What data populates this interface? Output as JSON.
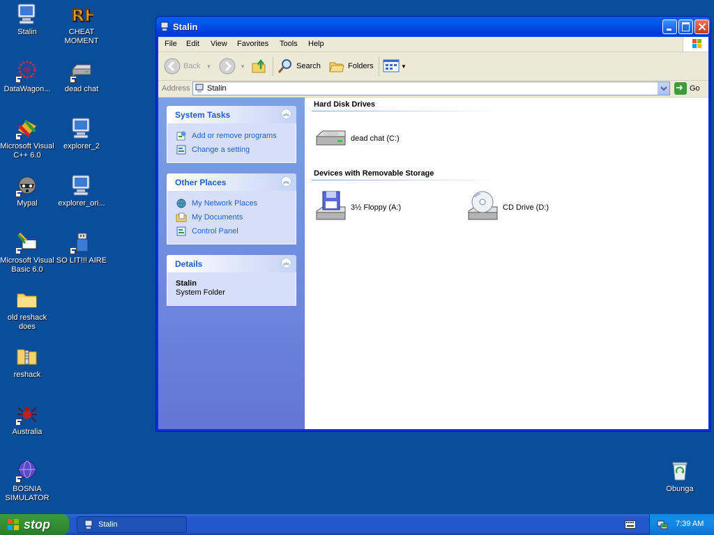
{
  "desktop": {
    "icons": [
      {
        "label": "Stalin",
        "icon": "my-computer-icon",
        "shortcut": false
      },
      {
        "label": "CHEAT MOMENT",
        "icon": "resource-hacker-icon",
        "shortcut": false
      },
      {
        "label": "DataWagon...",
        "icon": "datawagon-icon",
        "shortcut": true
      },
      {
        "label": "dead chat",
        "icon": "hard-disk-icon",
        "shortcut": true
      },
      {
        "label": "Microsoft Visual C++ 6.0",
        "icon": "visual-cpp-icon",
        "shortcut": true
      },
      {
        "label": "explorer_2",
        "icon": "computer-icon",
        "shortcut": false
      },
      {
        "label": "Mypal",
        "icon": "raccoon-icon",
        "shortcut": true
      },
      {
        "label": "explorer_ori...",
        "icon": "computer-icon",
        "shortcut": false
      },
      {
        "label": "Microsoft Visual Basic 6.0",
        "icon": "visual-basic-icon",
        "shortcut": true
      },
      {
        "label": "SO LIT!!! AIRE",
        "icon": "usb-drive-icon",
        "shortcut": true
      },
      {
        "label": "old reshack does",
        "icon": "folder-icon",
        "shortcut": false
      },
      {
        "label": "reshack",
        "icon": "zip-folder-icon",
        "shortcut": false
      },
      {
        "label": "Australia",
        "icon": "spider-icon",
        "shortcut": true
      },
      {
        "label": "BOSNIA SIMULATOR",
        "icon": "globe-app-icon",
        "shortcut": true
      },
      {
        "label": "Obunga",
        "icon": "recycle-bin-icon",
        "shortcut": false
      }
    ]
  },
  "window": {
    "title": "Stalin",
    "menu": [
      "File",
      "Edit",
      "View",
      "Favorites",
      "Tools",
      "Help"
    ],
    "toolbar": {
      "back": "Back",
      "search": "Search",
      "folders": "Folders"
    },
    "address": {
      "label": "Address",
      "value": "Stalin",
      "go": "Go"
    },
    "tasks": {
      "system_tasks": {
        "title": "System Tasks",
        "items": [
          "Add or remove programs",
          "Change a setting"
        ]
      },
      "other_places": {
        "title": "Other Places",
        "items": [
          "My Network Places",
          "My Documents",
          "Control Panel"
        ]
      },
      "details": {
        "title": "Details",
        "name": "Stalin",
        "type": "System Folder"
      }
    },
    "groups": [
      {
        "title": "Hard Disk Drives",
        "items": [
          {
            "label": "dead chat (C:)",
            "icon": "hard-drive-icon"
          }
        ]
      },
      {
        "title": "Devices with Removable Storage",
        "items": [
          {
            "label": "3½ Floppy (A:)",
            "icon": "floppy-drive-icon"
          },
          {
            "label": "CD Drive (D:)",
            "icon": "cd-drive-icon"
          }
        ]
      }
    ]
  },
  "taskbar": {
    "start_label": "stop",
    "task_button": "Stalin",
    "clock": "7:39 AM"
  }
}
